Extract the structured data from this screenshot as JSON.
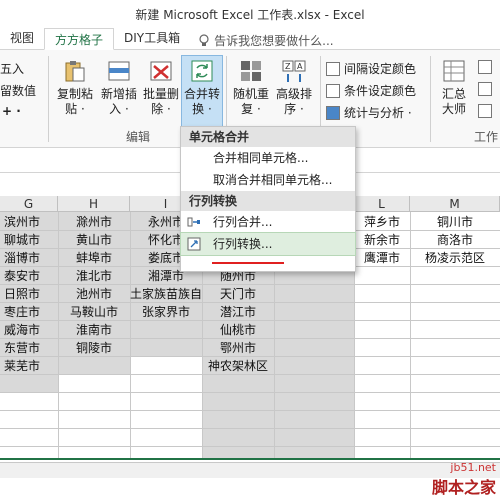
{
  "window": {
    "title": "新建 Microsoft Excel 工作表.xlsx - Excel"
  },
  "tabs": [
    "视图",
    "方方格子",
    "DIY工具箱"
  ],
  "tell_me": "告诉我您想要做什么...",
  "ribbon": {
    "left_partial": [
      "五入",
      "留数值",
      "+ ·"
    ],
    "buttons": {
      "copy_paste": "复制粘\n贴 ·",
      "add_insert": "新增插\n入 ·",
      "batch_delete": "批量删\n除 ·",
      "merge_convert": "合并转\n换 ·",
      "random_repeat": "随机重\n复 ·",
      "advanced_sort": "高级排\n序 ·",
      "summary": "汇总\n大师"
    },
    "small": [
      "间隔设定颜色",
      "条件设定颜色",
      "统计与分析 ·"
    ],
    "group_edit": "编辑",
    "group_right": "工作"
  },
  "menu": {
    "section1": "单元格合并",
    "item1": "合并相同单元格...",
    "item2": "取消合并相同单元格...",
    "section2": "行列转换",
    "item3": "行列合并...",
    "item4": "行列转换..."
  },
  "columns": [
    "G",
    "H",
    "I",
    "L",
    "M"
  ],
  "col_g": [
    "滨州市",
    "聊城市",
    "淄博市",
    "泰安市",
    "日照市",
    "枣庄市",
    "威海市",
    "东营市",
    "莱芜市"
  ],
  "col_h": [
    "滁州市",
    "黄山市",
    "蚌埠市",
    "淮北市",
    "池州市",
    "马鞍山市",
    "淮南市",
    "铜陵市"
  ],
  "col_i": [
    "永州市",
    "怀化市",
    "娄底市",
    "湘潭市",
    "土家族苗族自",
    "张家界市"
  ],
  "col_j": [
    "随州市",
    "天门市",
    "潜江市",
    "仙桃市",
    "鄂州市",
    "神农架林区"
  ],
  "col_k": [
    "萍乡市",
    "新余市",
    "鹰潭市"
  ],
  "col_m": [
    "铜川市",
    "商洛市",
    "杨凌示范区"
  ],
  "watermark": {
    "line1": "jb51.net",
    "line2": "脚本之家"
  }
}
